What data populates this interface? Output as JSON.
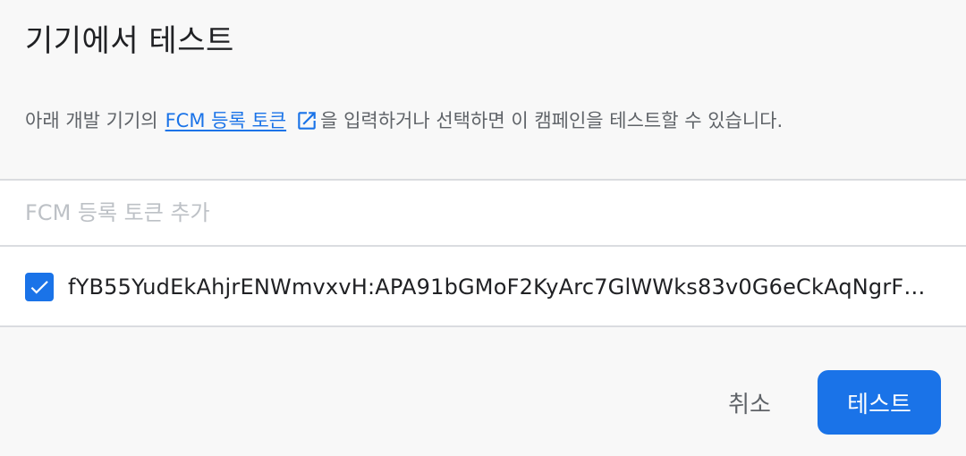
{
  "dialog": {
    "title": "기기에서 테스트",
    "description_prefix": "아래 개발 기기의",
    "link_text": "FCM 등록 토큰",
    "description_suffix": "을 입력하거나 선택하면 이 캠페인을 테스트할 수 있습니다.",
    "token_input_placeholder": "FCM 등록 토큰 추가",
    "tokens": [
      {
        "checked": true,
        "value": "fYB55YudEkAhjrENWmvxvH:APA91bGMoF2KyArc7GlWWks83v0G6eCkAqNgrFH…"
      }
    ],
    "cancel_label": "취소",
    "test_label": "테스트",
    "icons": {
      "link": "open-in-new-icon",
      "checkbox": "check-icon"
    },
    "colors": {
      "accent": "#1a73e8",
      "background": "#f8f8f8",
      "list_background": "#ffffff",
      "muted_text": "#5f6368"
    }
  }
}
